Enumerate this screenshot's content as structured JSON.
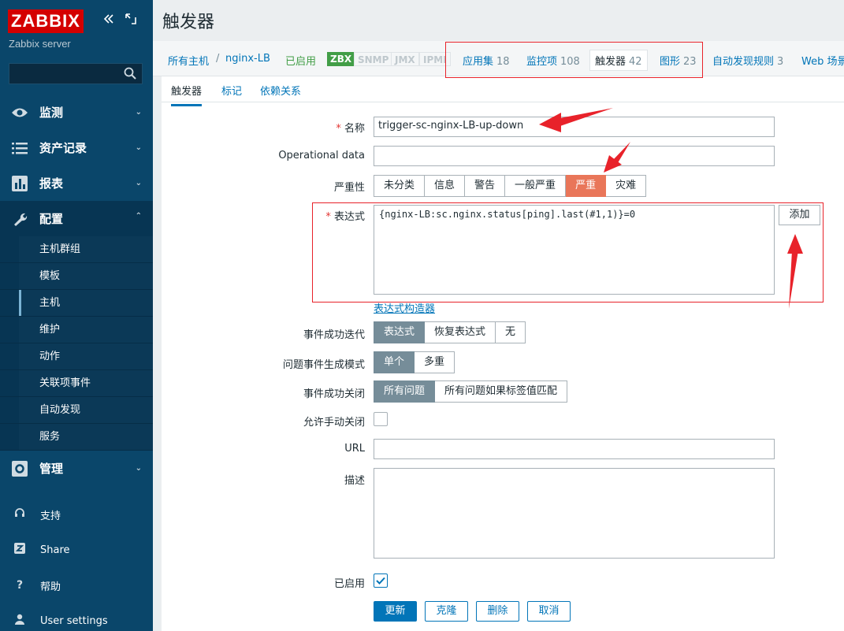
{
  "sidebar": {
    "logo": "ZABBIX",
    "server_name": "Zabbix server",
    "search_placeholder": "",
    "nav": [
      {
        "label": "监测",
        "icon": "eye-icon"
      },
      {
        "label": "资产记录",
        "icon": "list-icon"
      },
      {
        "label": "报表",
        "icon": "bar-chart-icon"
      },
      {
        "label": "配置",
        "icon": "wrench-icon"
      }
    ],
    "config_items": [
      "主机群组",
      "模板",
      "主机",
      "维护",
      "动作",
      "关联项事件",
      "自动发现",
      "服务"
    ],
    "active_config_item": "主机",
    "admin": {
      "label": "管理",
      "icon": "gear-icon"
    },
    "bottom": [
      {
        "label": "支持",
        "icon": "headset-icon"
      },
      {
        "label": "Share",
        "icon": "share-icon"
      },
      {
        "label": "帮助",
        "icon": "help-icon"
      },
      {
        "label": "User settings",
        "icon": "user-icon"
      }
    ]
  },
  "header": {
    "title": "触发器"
  },
  "hostbar": {
    "all_hosts": "所有主机",
    "separator": "/",
    "host": "nginx-LB",
    "status": "已启用",
    "badges": [
      "ZBX",
      "SNMP",
      "JMX",
      "IPMI"
    ],
    "tabs": [
      {
        "label": "应用集",
        "count": "18"
      },
      {
        "label": "监控项",
        "count": "108"
      },
      {
        "label": "触发器",
        "count": "42"
      },
      {
        "label": "图形",
        "count": "23"
      },
      {
        "label": "自动发现规则",
        "count": "3"
      },
      {
        "label": "Web 场景",
        "count": ""
      }
    ]
  },
  "subtabs": [
    "触发器",
    "标记",
    "依赖关系"
  ],
  "form": {
    "name_label": "名称",
    "name_value": "trigger-sc-nginx-LB-up-down",
    "opdata_label": "Operational data",
    "opdata_value": "",
    "severity_label": "严重性",
    "severity_options": [
      "未分类",
      "信息",
      "警告",
      "一般严重",
      "严重",
      "灾难"
    ],
    "severity_selected": "严重",
    "expression_label": "表达式",
    "expression_value": "{nginx-LB:sc.nginx.status[ping].last(#1,1)}=0",
    "add_button": "添加",
    "expression_builder_link": "表达式构造器",
    "ok_event_label": "事件成功迭代",
    "ok_event_options": [
      "表达式",
      "恢复表达式",
      "无"
    ],
    "problem_mode_label": "问题事件生成模式",
    "problem_mode_options": [
      "单个",
      "多重"
    ],
    "ok_close_label": "事件成功关闭",
    "ok_close_options": [
      "所有问题",
      "所有问题如果标签值匹配"
    ],
    "manual_close_label": "允许手动关闭",
    "url_label": "URL",
    "url_value": "",
    "description_label": "描述",
    "description_value": "",
    "enabled_label": "已启用",
    "buttons": {
      "update": "更新",
      "clone": "克隆",
      "delete": "删除",
      "cancel": "取消"
    }
  },
  "colors": {
    "sidebar": "#0a466a",
    "accent": "#0275b8",
    "severity_high": "#e97659",
    "annotation": "#e8222a"
  }
}
